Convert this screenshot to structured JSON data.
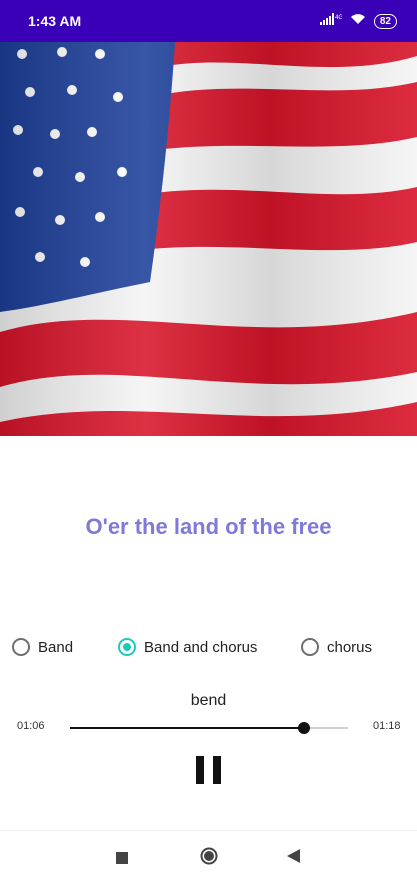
{
  "status_bar": {
    "time": "1:43 AM",
    "network": "4G",
    "battery": "82"
  },
  "banner": {
    "image": "waving-us-flag"
  },
  "lyric": {
    "text": "O'er the land of the free"
  },
  "mode_options": {
    "selected": "Band and chorus",
    "items": [
      {
        "label": "Band",
        "checked": false
      },
      {
        "label": "Band and chorus",
        "checked": true
      },
      {
        "label": "chorus",
        "checked": false
      }
    ]
  },
  "player": {
    "track_name": "bend",
    "current_time": "01:06",
    "total_time": "01:18",
    "progress_fraction": 0.84,
    "control": "pause-icon"
  },
  "nav_bar": {
    "buttons": [
      "recents-square-icon",
      "home-circle-icon",
      "back-triangle-icon"
    ]
  },
  "colors": {
    "status_bar": "#3a00b8",
    "lyric": "#7e7ad8",
    "radio_accent": "#1ec9b8",
    "seek_fill": "#111111"
  }
}
